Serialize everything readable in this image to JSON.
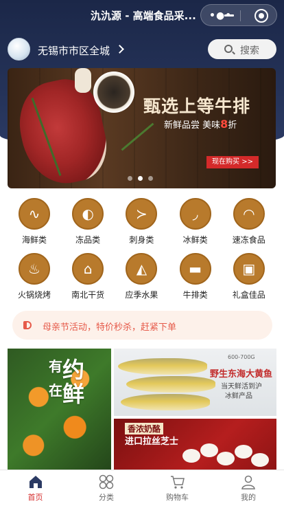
{
  "app": {
    "title": "氿氿源 - 高端食品采..."
  },
  "location": {
    "label": "无锡市市区全城"
  },
  "search": {
    "label": "搜索"
  },
  "banner": {
    "title": "甄选上等牛排",
    "subtitle_prefix": "新鲜品尝  美味",
    "subtitle_highlight": "8",
    "subtitle_suffix": "折",
    "button": "现在购买 >>",
    "dots": 3,
    "active_dot": 2
  },
  "categories": [
    {
      "label": "海鲜类",
      "icon": "seafood-icon"
    },
    {
      "label": "冻品类",
      "icon": "frozen-meat-icon"
    },
    {
      "label": "刺身类",
      "icon": "sashimi-fish-icon"
    },
    {
      "label": "冰鲜类",
      "icon": "shrimp-icon"
    },
    {
      "label": "速冻食品",
      "icon": "dumpling-icon"
    },
    {
      "label": "火锅烧烤",
      "icon": "hotpot-icon"
    },
    {
      "label": "南北干货",
      "icon": "mushroom-icon"
    },
    {
      "label": "应季水果",
      "icon": "watermelon-icon"
    },
    {
      "label": "牛排类",
      "icon": "steak-icon"
    },
    {
      "label": "礼盒佳品",
      "icon": "gift-icon"
    }
  ],
  "notice": {
    "text": "母亲节活动，特价秒杀，赶紧下单"
  },
  "promo_left": {
    "line1": "有",
    "line2": "约",
    "line3": "在",
    "line4": "鲜"
  },
  "promo_right_top": {
    "tag": "600-700G",
    "title": "野生东海大黄鱼",
    "sub1": "当天鲜活到沪",
    "sub2": "冰鲜产品"
  },
  "promo_right_bottom": {
    "title1": "香浓奶酪",
    "title2": "进口拉丝芝士"
  },
  "tabbar": [
    {
      "label": "首页",
      "icon": "home-icon",
      "active": true
    },
    {
      "label": "分类",
      "icon": "category-icon",
      "active": false
    },
    {
      "label": "购物车",
      "icon": "cart-icon",
      "active": false
    },
    {
      "label": "我的",
      "icon": "user-icon",
      "active": false
    }
  ],
  "colors": {
    "accent": "#d42a2a",
    "category_gold": "#b87a2c",
    "header_navy": "#1b2748",
    "notice_text": "#e65a4a"
  }
}
